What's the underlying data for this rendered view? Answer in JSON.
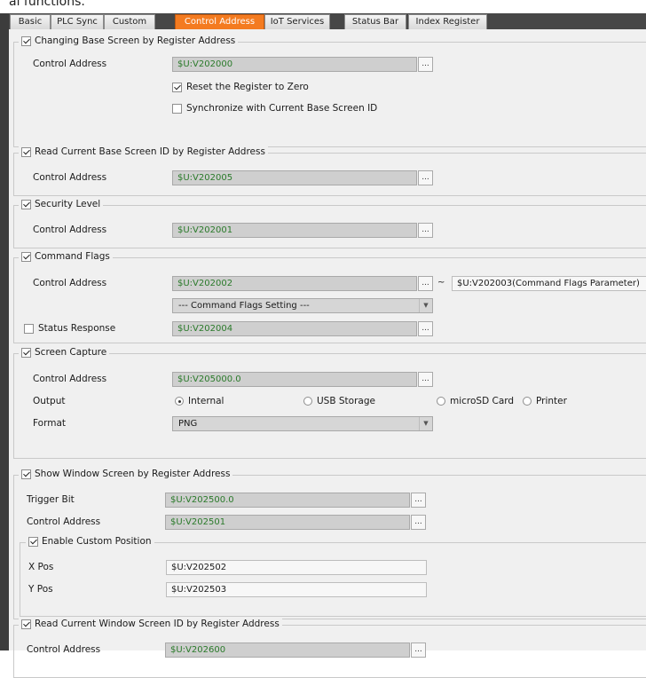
{
  "cut_text": "al functions.",
  "tabs": [
    "Basic",
    "PLC Sync",
    "Custom",
    "Control Address",
    "IoT Services",
    "Status Bar",
    "Index Register"
  ],
  "active_tab": "Control Address",
  "colors": {
    "active_tab": "#f47b20",
    "field_text": "#2a7a2a",
    "panel_bg": "#f0f0f0"
  },
  "icons": {
    "browse": "ellipsis-button-icon",
    "dropdown": "chevron-down-icon"
  },
  "browse_label": "...",
  "tilde": "~",
  "changing_base": {
    "title": "Changing Base Screen by Register Address",
    "enabled": true,
    "control_label": "Control Address",
    "control_value": "$U:V202000",
    "reset_label": "Reset the Register to Zero",
    "reset_checked": true,
    "sync_label": "Synchronize with Current Base Screen ID",
    "sync_checked": false
  },
  "read_base": {
    "title": "Read Current Base Screen ID by Register Address",
    "enabled": true,
    "control_label": "Control Address",
    "control_value": "$U:V202005"
  },
  "security": {
    "title": "Security Level",
    "enabled": true,
    "control_label": "Control Address",
    "control_value": "$U:V202001"
  },
  "command_flags": {
    "title": "Command Flags",
    "enabled": true,
    "control_label": "Control Address",
    "control_value": "$U:V202002",
    "param_value": "$U:V202003(Command Flags Parameter)",
    "setting_option": "--- Command Flags Setting ---",
    "status_label": "Status Response",
    "status_checked": false,
    "status_value": "$U:V202004"
  },
  "screen_capture": {
    "title": "Screen Capture",
    "enabled": true,
    "control_label": "Control Address",
    "control_value": "$U:V205000.0",
    "output_label": "Output",
    "output_options": [
      "Internal",
      "USB Storage",
      "microSD Card",
      "Printer"
    ],
    "output_selected": "Internal",
    "format_label": "Format",
    "format_value": "PNG"
  },
  "show_window": {
    "title": "Show Window Screen by Register Address",
    "enabled": true,
    "trigger_label": "Trigger Bit",
    "trigger_value": "$U:V202500.0",
    "control_label": "Control Address",
    "control_value": "$U:V202501",
    "custom_title": "Enable Custom Position",
    "custom_enabled": true,
    "xpos_label": "X Pos",
    "xpos_value": "$U:V202502",
    "ypos_label": "Y Pos",
    "ypos_value": "$U:V202503"
  },
  "read_window": {
    "title": "Read Current Window Screen ID by Register Address",
    "enabled": true,
    "control_label": "Control Address",
    "control_value": "$U:V202600"
  }
}
